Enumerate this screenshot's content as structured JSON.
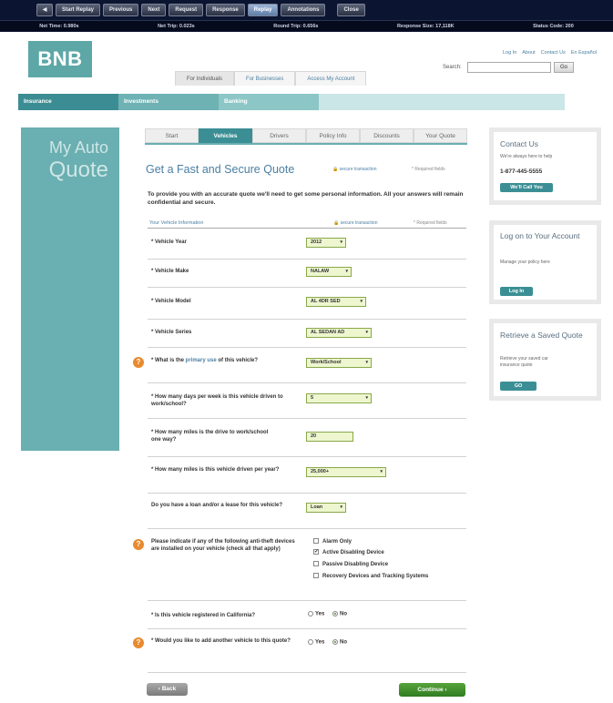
{
  "replay_toolbar": {
    "icon_label": "◀",
    "buttons": [
      "Start Replay",
      "Previous",
      "Next",
      "Request",
      "Response",
      "Replay",
      "Annotations",
      "Close"
    ],
    "active": "Replay",
    "stats": {
      "net_time": "Net Time: 0.980s",
      "net_trip": "Net Trip: 0.023s",
      "round_trip": "Round Trip: 0.656s",
      "response_size": "Response Size: 17,118K",
      "status_code": "Status Code: 200"
    }
  },
  "header": {
    "logo": "BNB",
    "top_links": [
      "Log In",
      "About",
      "Contact Us",
      "En Español"
    ],
    "search_label": "Search:",
    "search_value": "",
    "go_label": "Go",
    "nav_tabs": [
      "For Individuals",
      "For Businesses",
      "Access My Account"
    ]
  },
  "product_bar": [
    "Insurance",
    "Investments",
    "Banking"
  ],
  "left_panel": {
    "line1": "My Auto",
    "line2": "Quote"
  },
  "steps": [
    "Start",
    "Vehicles",
    "Drivers",
    "Policy Info",
    "Discounts",
    "Your Quote"
  ],
  "active_step": "Vehicles",
  "form": {
    "title": "Get a Fast and Secure Quote",
    "secure_label": "secure transaction",
    "required_note": "* Required fields",
    "intro": "To provide you with an accurate quote we'll need to get some personal information. All your answers will remain confidential and secure.",
    "section_label": "Your Vehicle Information",
    "vehicle_year_label": "* Vehicle Year",
    "vehicle_year_value": "2012",
    "vehicle_make_label": "* Vehicle Make",
    "vehicle_make_value": "NALAW",
    "vehicle_model_label": "* Vehicle Model",
    "vehicle_model_value": "AL 4DR SED",
    "vehicle_series_label": "* Vehicle Series",
    "vehicle_series_value": "AL SEDAN AD",
    "primary_use_pre": "* What is the ",
    "primary_use_link": "primary use",
    "primary_use_post": " of this vehicle?",
    "primary_use_value": "Work/School",
    "days_label": "* How many days per week is this vehicle driven to work/school?",
    "days_value": "5",
    "miles_drive_label": "* How many miles is the drive to work/school one way?",
    "miles_drive_value": "20",
    "miles_year_label": "* How many miles is this vehicle driven per year?",
    "miles_year_value": "25,000+",
    "loan_label": "Do you have a loan and/or a lease for this vehicle?",
    "loan_value": "Loan",
    "antitheft_label": "Please indicate if any of the following anti-theft devices are installed on your vehicle (check all that apply)",
    "antitheft_options": [
      {
        "label": "Alarm Only",
        "checked": false
      },
      {
        "label": "Active Disabling Device",
        "checked": true
      },
      {
        "label": "Passive Disabling Device",
        "checked": false
      },
      {
        "label": "Recovery Devices and Tracking Systems",
        "checked": false
      }
    ],
    "california_label": "* Is this vehicle registered in California?",
    "another_label": "* Would you like to add another vehicle to this quote?",
    "yes_label": "Yes",
    "no_label": "No",
    "california_value": "No",
    "another_value": "No",
    "back_label": "‹ Back",
    "continue_label": "Continue ›"
  },
  "sidebar": {
    "contact": {
      "title": "Contact Us",
      "desc": "We're always here to help",
      "phone": "1-877-445-5555",
      "button": "We'll Call You"
    },
    "login": {
      "title": "Log on to Your Account",
      "desc": "Manage your policy here",
      "button": "Log In"
    },
    "retrieve": {
      "title": "Retrieve a Saved Quote",
      "desc": "Retrieve your saved car insurance quote",
      "button": "GO"
    }
  },
  "colors": {
    "teal": "#3b8f94",
    "accent_green": "#2f7d21",
    "help_orange": "#e88a2e",
    "field_bg": "#edf6cf"
  }
}
